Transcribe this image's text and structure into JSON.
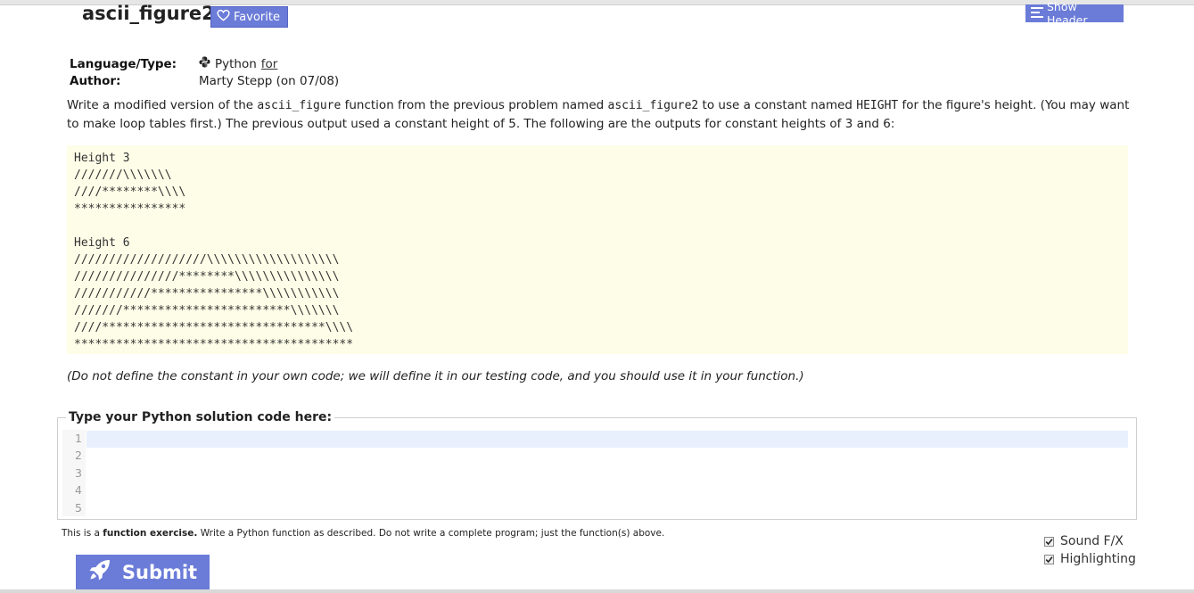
{
  "problem": {
    "title": "ascii_figure2",
    "favorite_label": "Favorite",
    "show_header_label": "Show Header"
  },
  "meta": {
    "language_label": "Language/Type:",
    "language_value": "Python",
    "language_link": "for",
    "author_label": "Author:",
    "author_value": "Marty Stepp (on 07/08)"
  },
  "description": {
    "part1": "Write a modified version of the ",
    "code1": "ascii_figure",
    "part2": " function from the previous problem named ",
    "code2": "ascii_figure2",
    "part3": " to use a constant named ",
    "code3": "HEIGHT",
    "part4": " for the figure's height. (You may want to make loop tables first.) The previous output used a constant height of 5. The following are the outputs for constant heights of 3 and 6:"
  },
  "sample_output": "Height 3\n///////\\\\\\\\\\\\\\\n////********\\\\\\\\\n****************\n\nHeight 6\n///////////////////\\\\\\\\\\\\\\\\\\\\\\\\\\\\\\\\\\\\\\\n///////////////********\\\\\\\\\\\\\\\\\\\\\\\\\\\\\\\n///////////****************\\\\\\\\\\\\\\\\\\\\\\\n///////************************\\\\\\\\\\\\\\\n////********************************\\\\\\\\\n****************************************",
  "note": "(Do not define the constant in your own code; we will define it in our testing code, and you should use it in your function.)",
  "editor": {
    "legend": "Type your Python solution code here:",
    "line_numbers": [
      "1",
      "2",
      "3",
      "4",
      "5"
    ]
  },
  "exercise_info": {
    "prefix": "This is a ",
    "bold": "function exercise.",
    "suffix": " Write a Python function as described. Do not write a complete program; just the function(s) above."
  },
  "options": {
    "sound_label": "Sound F/X",
    "highlight_label": "Highlighting"
  },
  "submit_label": "Submit",
  "colors": {
    "accent": "#6a7bd8",
    "output_bg": "#fefee8",
    "active_line": "#e8f0fd"
  }
}
